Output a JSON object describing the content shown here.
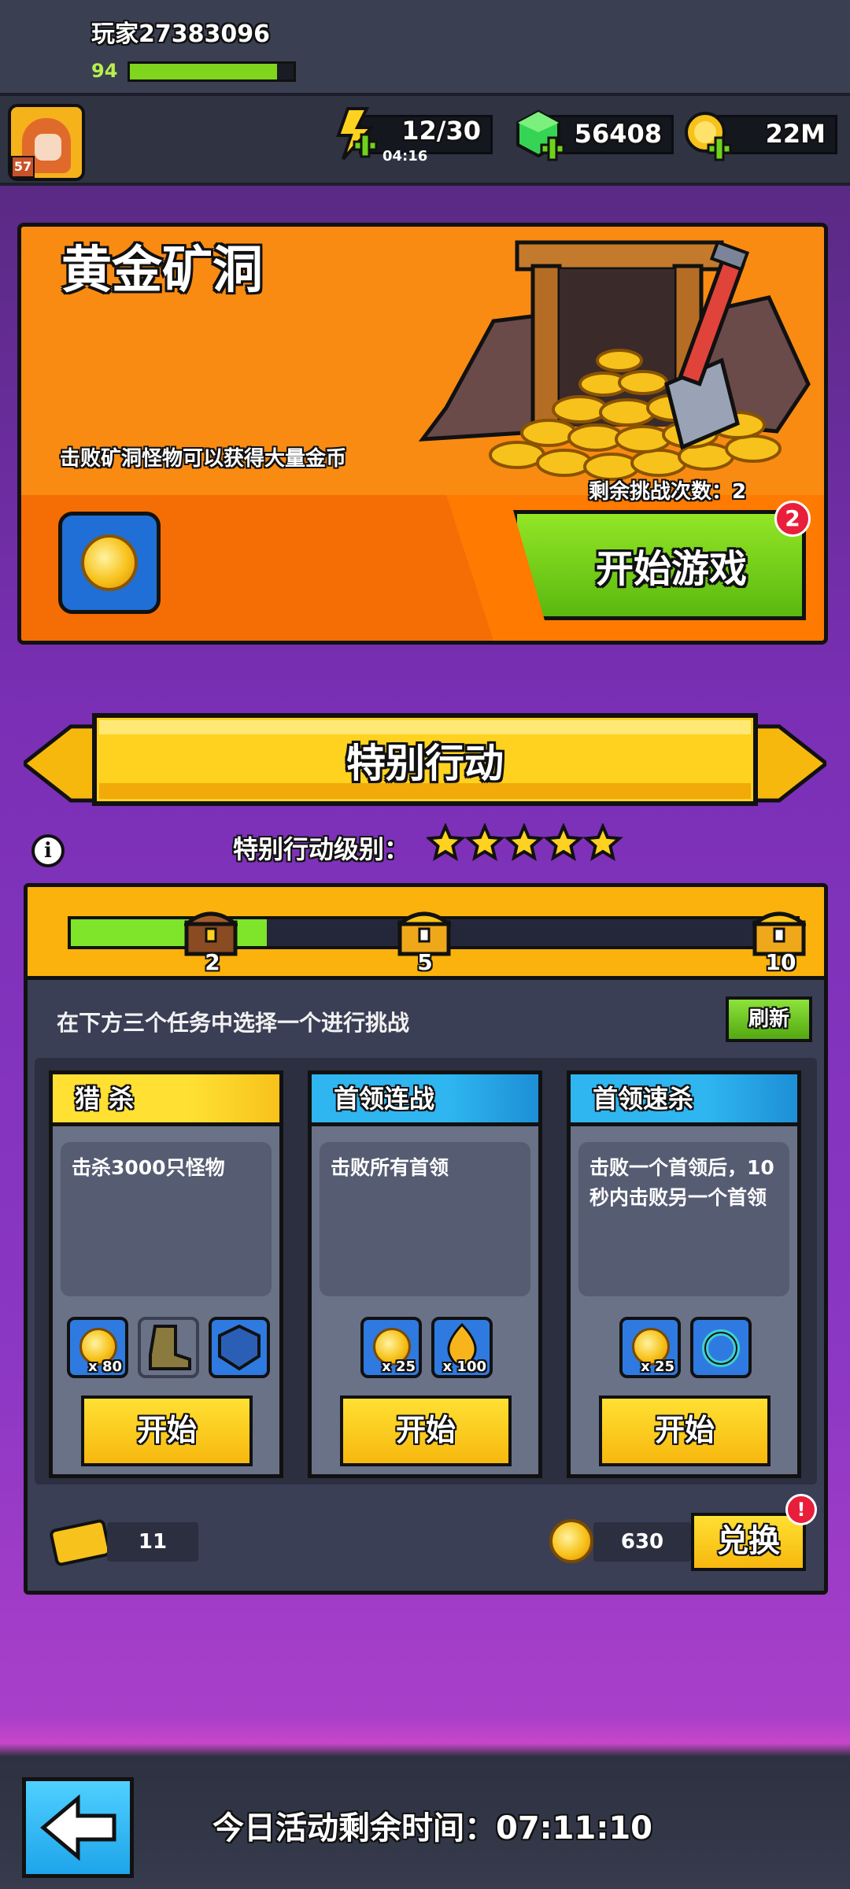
{
  "player": {
    "name": "玩家27383096",
    "avatar_level": "57",
    "level": "94",
    "xp_fraction": 0.9
  },
  "resources": {
    "energy": "12/30",
    "energy_timer": "04:16",
    "gems": "56408",
    "coins": "22M"
  },
  "gold_mine": {
    "title": "黄金矿洞",
    "description": "击败矿洞怪物可以获得大量金币",
    "remaining_label": "剩余挑战次数：2",
    "start_label": "开始游戏",
    "badge": "2"
  },
  "special_ops": {
    "title": "特别行动",
    "level_label": "特别行动级别：",
    "stars": 5,
    "progress_fraction": 0.27,
    "milestones": [
      "2",
      "5",
      "10"
    ],
    "choose_text": "在下方三个任务中选择一个进行挑战",
    "refresh_label": "刷新",
    "tasks": [
      {
        "title": "猎 杀",
        "desc": "击杀3000只怪物",
        "start": "开始",
        "reward_qty": "x 80"
      },
      {
        "title": "首领连战",
        "desc": "击败所有首领",
        "start": "开始",
        "reward_qty": "x 25",
        "reward_qty2": "x 100"
      },
      {
        "title": "首领速杀",
        "desc": "击败一个首领后，10秒内击败另一个首领",
        "start": "开始",
        "reward_qty": "x 25"
      }
    ],
    "tickets": "11",
    "tokens": "630",
    "exchange_label": "兑换",
    "exchange_alert": "!"
  },
  "footer": {
    "time_label": "今日活动剩余时间：07:11:10"
  },
  "colors": {
    "accent_orange": "#f98b12",
    "accent_green": "#7fd61c",
    "panel": "#3a3f55"
  }
}
